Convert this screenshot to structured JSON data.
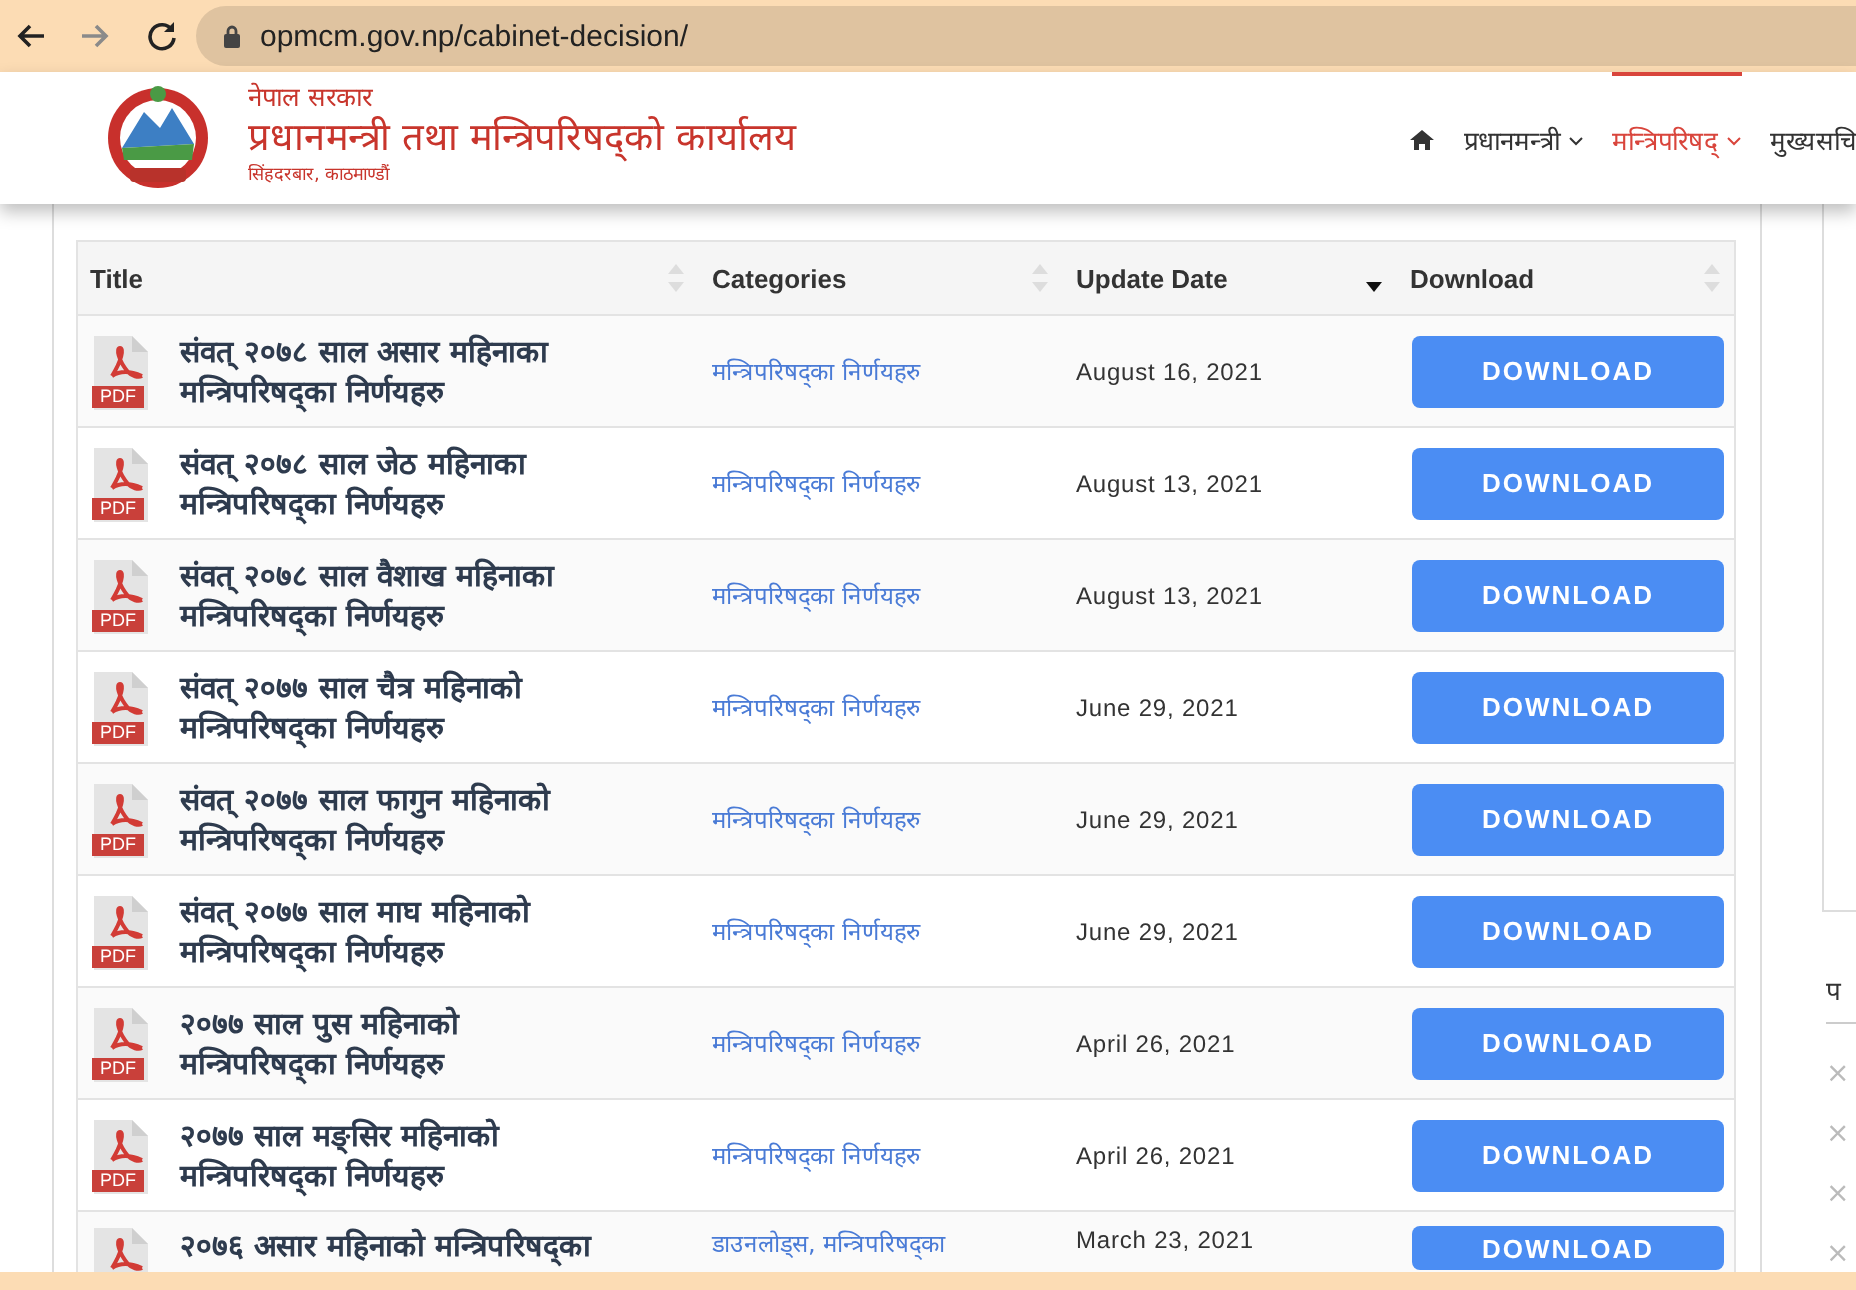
{
  "browser": {
    "url": "opmcm.gov.np/cabinet-decision/"
  },
  "header": {
    "org_top": "नेपाल सरकार",
    "org_name": "प्रधानमन्त्री तथा मन्त्रिपरिषद्को कार्यालय",
    "org_sub": "सिंहदरबार, काठमाण्डौं"
  },
  "nav": [
    {
      "label": "प्रधानमन्त्री",
      "selected": false,
      "dropdown": true
    },
    {
      "label": "मन्त्रिपरिषद्",
      "selected": true,
      "dropdown": true
    },
    {
      "label": "मुख्यसचि",
      "selected": false,
      "dropdown": false
    }
  ],
  "table": {
    "columns": [
      {
        "label": "Title",
        "sorted_desc": false
      },
      {
        "label": "Categories",
        "sorted_desc": false
      },
      {
        "label": "Update Date",
        "sorted_desc": true
      },
      {
        "label": "Download",
        "sorted_desc": false
      }
    ],
    "rows": [
      {
        "file_type": "PDF",
        "title": "संवत् २०७८ साल असार महिनाका मन्त्रिपरिषद्का निर्णयहरु",
        "category": "मन्त्रिपरिषद्का निर्णयहरु",
        "date": "August 16, 2021",
        "button": "DOWNLOAD"
      },
      {
        "file_type": "PDF",
        "title": "संवत् २०७८ साल जेठ महिनाका मन्त्रिपरिषद्का निर्णयहरु",
        "category": "मन्त्रिपरिषद्का निर्णयहरु",
        "date": "August 13, 2021",
        "button": "DOWNLOAD"
      },
      {
        "file_type": "PDF",
        "title": "संवत् २०७८ साल वैशाख महिनाका मन्त्रिपरिषद्का निर्णयहरु",
        "category": "मन्त्रिपरिषद्का निर्णयहरु",
        "date": "August 13, 2021",
        "button": "DOWNLOAD"
      },
      {
        "file_type": "PDF",
        "title": "संवत् २०७७ साल चैत्र महिनाको मन्त्रिपरिषद्का निर्णयहरु",
        "category": "मन्त्रिपरिषद्का निर्णयहरु",
        "date": "June 29, 2021",
        "button": "DOWNLOAD"
      },
      {
        "file_type": "PDF",
        "title": "संवत् २०७७ साल फागुन महिनाको मन्त्रिपरिषद्का निर्णयहरु",
        "category": "मन्त्रिपरिषद्का निर्णयहरु",
        "date": "June 29, 2021",
        "button": "DOWNLOAD"
      },
      {
        "file_type": "PDF",
        "title": "संवत् २०७७ साल माघ महिनाको मन्त्रिपरिषद्का निर्णयहरु",
        "category": "मन्त्रिपरिषद्का निर्णयहरु",
        "date": "June 29, 2021",
        "button": "DOWNLOAD"
      },
      {
        "file_type": "PDF",
        "title": "२०७७ साल पुस महिनाको मन्त्रिपरिषद्का निर्णयहरु",
        "category": "मन्त्रिपरिषद्का निर्णयहरु",
        "date": "April 26, 2021",
        "button": "DOWNLOAD"
      },
      {
        "file_type": "PDF",
        "title": "२०७७ साल मङ्सिर महिनाको मन्त्रिपरिषद्का निर्णयहरु",
        "category": "मन्त्रिपरिषद्का निर्णयहरु",
        "date": "April 26, 2021",
        "button": "DOWNLOAD"
      },
      {
        "title": "२०७६ असार महिनाको मन्त्रिपरिषद्का",
        "category": "डाउनलोड्स, मन्त्रिपरिषद्का",
        "date": "March 23, 2021",
        "button": "DOWNLOAD"
      }
    ]
  },
  "sidebar": {
    "heading": "प",
    "marks": [
      "×",
      "×",
      "×",
      "×"
    ]
  }
}
